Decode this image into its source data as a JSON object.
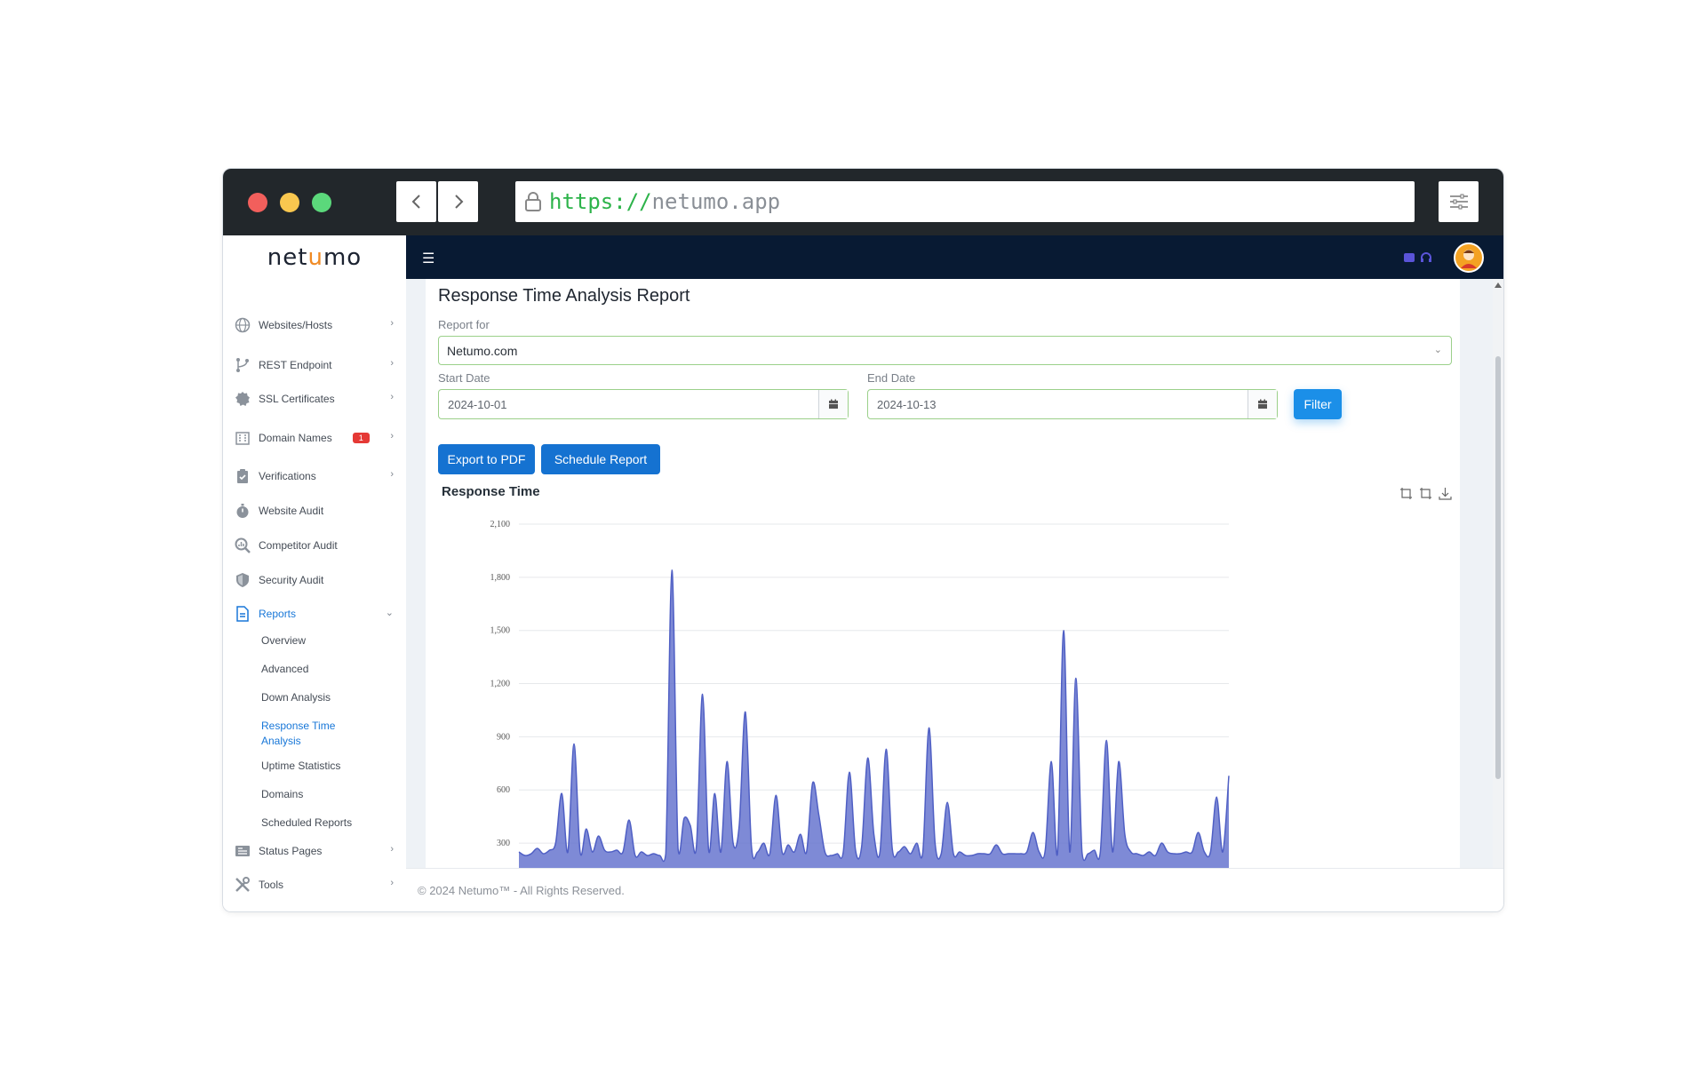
{
  "browser": {
    "url_protocol": "https://",
    "url_host": "netumo.app"
  },
  "app": {
    "logo_prefix": "net",
    "logo_accent": "u",
    "logo_suffix": "mo"
  },
  "sidebar": {
    "items": [
      {
        "label": "Websites/Hosts",
        "icon": "globe-icon"
      },
      {
        "label": "REST Endpoint",
        "icon": "branch-icon"
      },
      {
        "label": "SSL Certificates",
        "icon": "certificate-icon"
      },
      {
        "label": "Domain Names",
        "icon": "building-icon",
        "badge": "1"
      },
      {
        "label": "Verifications",
        "icon": "clipboard-check-icon"
      },
      {
        "label": "Website Audit",
        "icon": "stopwatch-icon"
      },
      {
        "label": "Competitor Audit",
        "icon": "magnifier-chart-icon"
      },
      {
        "label": "Security Audit",
        "icon": "shield-icon"
      },
      {
        "label": "Reports",
        "icon": "document-icon"
      },
      {
        "label": "Status Pages",
        "icon": "newspaper-icon"
      },
      {
        "label": "Tools",
        "icon": "tools-icon"
      }
    ],
    "reports_sub": [
      {
        "label": "Overview"
      },
      {
        "label": "Advanced"
      },
      {
        "label": "Down Analysis"
      },
      {
        "label": "Response Time Analysis"
      },
      {
        "label": "Uptime Statistics"
      },
      {
        "label": "Domains"
      },
      {
        "label": "Scheduled Reports"
      }
    ]
  },
  "page": {
    "title": "Response Time Analysis Report",
    "report_for_label": "Report for",
    "report_for_value": "Netumo.com",
    "start_label": "Start Date",
    "start_value": "2024-10-01",
    "end_label": "End Date",
    "end_value": "2024-10-13",
    "filter_label": "Filter",
    "export_label": "Export to PDF",
    "schedule_label": "Schedule Report"
  },
  "chart_data": {
    "type": "area",
    "title": "Response Time",
    "ylim": [
      150,
      2100
    ],
    "y_ticks": [
      300,
      600,
      900,
      1200,
      1500,
      1800,
      2100
    ],
    "y_tick_labels": [
      "300",
      "600",
      "900",
      "1,200",
      "1,500",
      "1,800",
      "2,100"
    ],
    "color": "#6775cf",
    "grid": true,
    "values": [
      250,
      230,
      240,
      270,
      240,
      260,
      300,
      580,
      250,
      860,
      250,
      380,
      250,
      340,
      260,
      250,
      260,
      250,
      430,
      230,
      250,
      230,
      240,
      230,
      240,
      1840,
      270,
      440,
      400,
      280,
      1140,
      260,
      580,
      250,
      760,
      300,
      400,
      1040,
      280,
      250,
      300,
      240,
      570,
      250,
      290,
      250,
      350,
      250,
      640,
      460,
      250,
      230,
      240,
      250,
      700,
      260,
      280,
      780,
      350,
      250,
      830,
      270,
      250,
      280,
      240,
      300,
      250,
      950,
      300,
      240,
      530,
      240,
      250,
      230,
      230,
      240,
      240,
      240,
      290,
      240,
      240,
      240,
      240,
      250,
      360,
      250,
      260,
      760,
      240,
      1500,
      250,
      1230,
      250,
      240,
      260,
      250,
      880,
      250,
      760,
      350,
      250,
      240,
      230,
      250,
      230,
      300,
      250,
      240,
      240,
      250,
      250,
      360,
      250,
      250,
      560,
      250,
      680
    ]
  },
  "footer": {
    "text": "© 2024 Netumo™ - All Rights Reserved."
  }
}
